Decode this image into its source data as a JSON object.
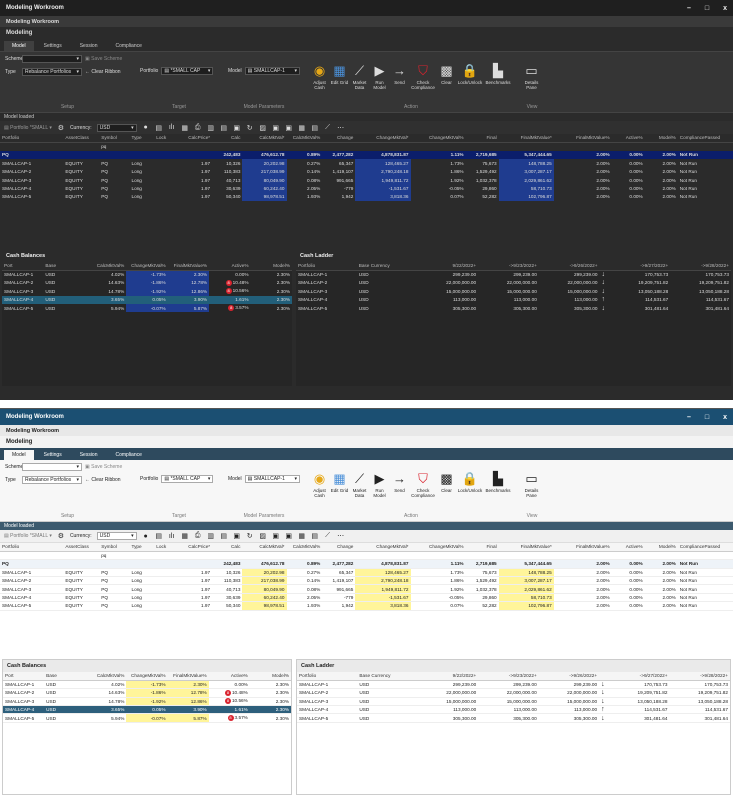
{
  "window": {
    "title": "Modeling Workroom",
    "minimize": "–",
    "maximize": "□",
    "close": "x"
  },
  "app": {
    "title": "Modeling Workroom",
    "section": "Modeling"
  },
  "tabs": [
    "Model",
    "Settings",
    "Session",
    "Compliance"
  ],
  "ribbon": {
    "scheme_label": "Scheme",
    "scheme_value": "",
    "save_scheme": "Save Scheme",
    "type_label": "Type",
    "type_value": "Rebalance Portfolios",
    "clear_ribbon": "Clear Ribbon",
    "setup_label": "Setup",
    "portfolio_label": "Portfolio",
    "portfolio_value": "*SMALL CAP",
    "target_label": "Target",
    "model_label": "Model",
    "model_value": "SMALLCAP-1",
    "model_params_label": "Model Parameters",
    "buttons": [
      "Adjust Cash",
      "Edit Grid",
      "Market Data",
      "Run Model",
      "Send",
      "Check Compliance",
      "Clear",
      "Lock/Unlock",
      "Benchmarks",
      "Details Pane"
    ],
    "action_label": "Action",
    "view_label": "View"
  },
  "status": "Model loaded",
  "toolbar": {
    "portfolio": "Portfolio",
    "small": "*SMALL",
    "currency_label": "Currency:",
    "currency_value": "USD"
  },
  "grid": {
    "headers": [
      "Portfolio",
      "AssetClass",
      "Symbol",
      "Type",
      "Lock",
      "CalcPrice*",
      "Calc",
      "CalcMktVal*",
      "CalcMktVal%",
      "Change",
      "ChangeMktVal*",
      "ChangeMktVal%",
      "Final",
      "FinalMktValue*",
      "FinalMktValue%",
      "Active%",
      "Model%",
      "CompliancePassed"
    ],
    "filter_symbol": "pq",
    "group": [
      "PQ",
      "",
      "",
      "",
      "",
      "",
      "242,483",
      "476,612.78",
      "0.89%",
      "2,477,282",
      "4,878,831.87",
      "1.11%",
      "2,719,685",
      "5,347,444.65",
      "2.00%",
      "0.00%",
      "2.00%",
      "Not Run"
    ],
    "rows": [
      [
        "SMALLCAP-1",
        "EQUITY",
        "PQ",
        "Long",
        "",
        "1.97",
        "10,326",
        "20,202.98",
        "0.27%",
        "65,347",
        "128,465.27",
        "1.73%",
        "75,673",
        "148,788.25",
        "2.00%",
        "0.00%",
        "2.00%",
        "Not Run"
      ],
      [
        "SMALLCAP-2",
        "EQUITY",
        "PQ",
        "Long",
        "",
        "1.97",
        "110,383",
        "217,038.99",
        "0.14%",
        "1,419,107",
        "2,790,248.18",
        "1.86%",
        "1,529,492",
        "3,007,287.17",
        "2.00%",
        "0.00%",
        "2.00%",
        "Not Run"
      ],
      [
        "SMALLCAP-3",
        "EQUITY",
        "PQ",
        "Long",
        "",
        "1.97",
        "40,713",
        "80,049.90",
        "0.08%",
        "991,665",
        "1,949,811.72",
        "1.92%",
        "1,032,378",
        "2,029,861.62",
        "2.00%",
        "0.00%",
        "2.00%",
        "Not Run"
      ],
      [
        "SMALLCAP-4",
        "EQUITY",
        "PQ",
        "Long",
        "",
        "1.97",
        "30,639",
        "60,242.40",
        "2.05%",
        "-779",
        "-1,531.67",
        "-0.05%",
        "29,860",
        "58,710.73",
        "2.00%",
        "0.00%",
        "2.00%",
        "Not Run"
      ],
      [
        "SMALLCAP-5",
        "EQUITY",
        "PQ",
        "Long",
        "",
        "1.97",
        "50,340",
        "98,978.51",
        "1.93%",
        "1,942",
        "3,818.36",
        "0.07%",
        "52,282",
        "102,796.87",
        "2.00%",
        "0.00%",
        "2.00%",
        "Not Run"
      ]
    ]
  },
  "cash_balances": {
    "title": "Cash Balances",
    "headers": [
      "Port",
      "Base",
      "CalcMktVal%",
      "ChangeMktVal%",
      "FinalMktValue%",
      "Active%",
      "Model%"
    ],
    "rows": [
      [
        "SMALLCAP-1",
        "USD",
        "4.02%",
        "-1.73%",
        "2.30%",
        "",
        "0.00%",
        "2.30%"
      ],
      [
        "SMALLCAP-2",
        "USD",
        "14.63%",
        "-1.86%",
        "12.78%",
        "8",
        "10.48%",
        "2.30%"
      ],
      [
        "SMALLCAP-3",
        "USD",
        "14.78%",
        "-1.92%",
        "12.86%",
        "8",
        "10.56%",
        "2.30%"
      ],
      [
        "SMALLCAP-4",
        "USD",
        "3.65%",
        "0.05%",
        "3.90%",
        "",
        "1.61%",
        "2.30%"
      ],
      [
        "SMALLCAP-5",
        "USD",
        "5.94%",
        "-0.07%",
        "5.87%",
        "8",
        "3.57%",
        "2.30%"
      ]
    ]
  },
  "cash_ladder": {
    "title": "Cash Ladder",
    "headers": [
      "Portfolio",
      "Base Currency",
      "9/22/2022+",
      "->9/23/2022+",
      "->9/26/2022+",
      "",
      "->9/27/2022+",
      "->9/28/2022+"
    ],
    "rows": [
      [
        "SMALLCAP-1",
        "USD",
        "299,239.00",
        "299,239.00",
        "299,239.00",
        "dn",
        "170,753.73",
        "170,753.73"
      ],
      [
        "SMALLCAP-2",
        "USD",
        "22,000,000.00",
        "22,000,000.00",
        "22,000,000.00",
        "dn",
        "19,209,751.82",
        "19,209,751.82"
      ],
      [
        "SMALLCAP-3",
        "USD",
        "15,000,000.00",
        "15,000,000.00",
        "15,000,000.00",
        "dn",
        "13,050,188.28",
        "13,050,188.28"
      ],
      [
        "SMALLCAP-4",
        "USD",
        "113,000.00",
        "113,000.00",
        "113,000.00",
        "up",
        "114,531.67",
        "114,531.67"
      ],
      [
        "SMALLCAP-5",
        "USD",
        "305,300.00",
        "305,300.00",
        "305,300.00",
        "dn",
        "301,481.64",
        "301,481.64"
      ]
    ]
  }
}
